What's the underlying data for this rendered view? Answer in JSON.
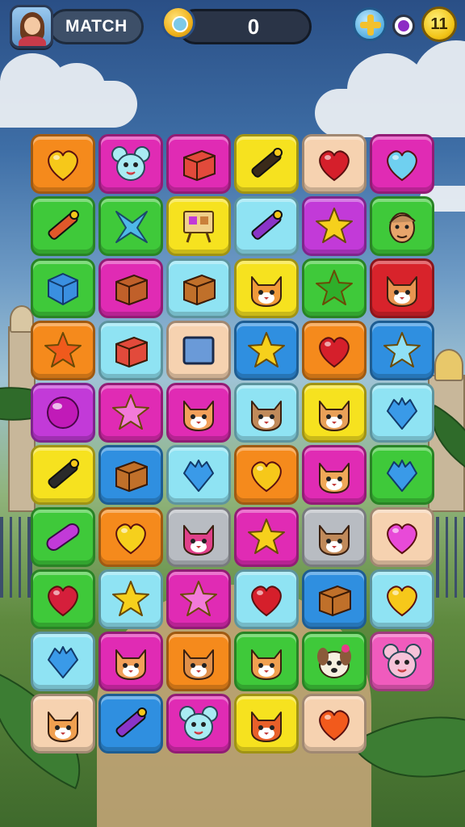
{
  "header": {
    "mode_label": "MATCH",
    "score": "0",
    "coins": "11"
  },
  "icons": {
    "avatar": "player-avatar",
    "badge": "sun-badge-icon",
    "plus": "plus-icon",
    "toggle": "dot-icon",
    "coin": "coin-icon"
  },
  "tile_colors": {
    "orange": "#f58a1c",
    "magenta": "#e02bb4",
    "yellow": "#f6e21f",
    "peach": "#f6d2b0",
    "green": "#3fc93a",
    "cyan": "#8fe3f3",
    "blue": "#2f8fe0",
    "purple": "#c23ad8",
    "red": "#d8232b",
    "gray": "#b8bcc2",
    "pink": "#f05bbd"
  },
  "board": {
    "rows": 10,
    "cols": 6,
    "cells": [
      [
        {
          "bg": "orange",
          "icon": "heart",
          "color": "#f6c81a"
        },
        {
          "bg": "magenta",
          "icon": "mouse",
          "color": "#a9ecf3"
        },
        {
          "bg": "magenta",
          "icon": "box",
          "color": "#e24a3b"
        },
        {
          "bg": "yellow",
          "icon": "marker",
          "color": "#3a2a1a"
        },
        {
          "bg": "peach",
          "icon": "heart",
          "color": "#d51f2b"
        },
        {
          "bg": "magenta",
          "icon": "heart",
          "color": "#6fd0f0"
        }
      ],
      [
        {
          "bg": "green",
          "icon": "marker",
          "color": "#e0582a"
        },
        {
          "bg": "green",
          "icon": "star4",
          "color": "#4fb8e8"
        },
        {
          "bg": "yellow",
          "icon": "board",
          "color": "#c9803a"
        },
        {
          "bg": "cyan",
          "icon": "marker",
          "color": "#8a34c8"
        },
        {
          "bg": "purple",
          "icon": "star",
          "color": "#f6d01c"
        },
        {
          "bg": "green",
          "icon": "face",
          "color": "#e8a56b"
        }
      ],
      [
        {
          "bg": "green",
          "icon": "cube",
          "color": "#3a8fe0"
        },
        {
          "bg": "magenta",
          "icon": "box",
          "color": "#c0602a"
        },
        {
          "bg": "cyan",
          "icon": "box",
          "color": "#c0702a"
        },
        {
          "bg": "yellow",
          "icon": "cat",
          "color": "#f09a3a"
        },
        {
          "bg": "green",
          "icon": "star",
          "color": "#2fae2a"
        },
        {
          "bg": "red",
          "icon": "cat",
          "color": "#e89450"
        }
      ],
      [
        {
          "bg": "orange",
          "icon": "star",
          "color": "#f05a1c"
        },
        {
          "bg": "cyan",
          "icon": "box",
          "color": "#e24a3b"
        },
        {
          "bg": "peach",
          "icon": "square",
          "color": "#6a9ad8"
        },
        {
          "bg": "blue",
          "icon": "star",
          "color": "#f6d01c"
        },
        {
          "bg": "orange",
          "icon": "heart",
          "color": "#d51f2b"
        },
        {
          "bg": "blue",
          "icon": "star",
          "color": "#8fe0f6"
        }
      ],
      [
        {
          "bg": "purple",
          "icon": "ball",
          "color": "#c11ab8"
        },
        {
          "bg": "magenta",
          "icon": "star",
          "color": "#f27ad9"
        },
        {
          "bg": "magenta",
          "icon": "cat",
          "color": "#f2a05a"
        },
        {
          "bg": "cyan",
          "icon": "cat",
          "color": "#c08a5a"
        },
        {
          "bg": "yellow",
          "icon": "cat",
          "color": "#e8a058"
        },
        {
          "bg": "cyan",
          "icon": "diamond",
          "color": "#3a9ae8"
        }
      ],
      [
        {
          "bg": "yellow",
          "icon": "marker",
          "color": "#2a2a2a"
        },
        {
          "bg": "blue",
          "icon": "box",
          "color": "#c0702a"
        },
        {
          "bg": "cyan",
          "icon": "diamond",
          "color": "#3a9ae8"
        },
        {
          "bg": "orange",
          "icon": "heart",
          "color": "#f6c81a"
        },
        {
          "bg": "magenta",
          "icon": "cat",
          "color": "#f0a858"
        },
        {
          "bg": "green",
          "icon": "diamond",
          "color": "#3a9ae8"
        }
      ],
      [
        {
          "bg": "green",
          "icon": "pill",
          "color": "#c23ad8"
        },
        {
          "bg": "orange",
          "icon": "heart",
          "color": "#f6d01c"
        },
        {
          "bg": "gray",
          "icon": "cat",
          "color": "#e0408a"
        },
        {
          "bg": "magenta",
          "icon": "star",
          "color": "#f6d01c"
        },
        {
          "bg": "gray",
          "icon": "cat",
          "color": "#c08a5a"
        },
        {
          "bg": "peach",
          "icon": "heart",
          "color": "#e84ad8"
        }
      ],
      [
        {
          "bg": "green",
          "icon": "heart",
          "color": "#d51f3b"
        },
        {
          "bg": "cyan",
          "icon": "star",
          "color": "#f6d01c"
        },
        {
          "bg": "magenta",
          "icon": "star",
          "color": "#f27ad9"
        },
        {
          "bg": "cyan",
          "icon": "heart",
          "color": "#d51f2b"
        },
        {
          "bg": "blue",
          "icon": "box",
          "color": "#c0702a"
        },
        {
          "bg": "cyan",
          "icon": "heart",
          "color": "#f6c81a"
        }
      ],
      [
        {
          "bg": "cyan",
          "icon": "diamond",
          "color": "#3a9ae8"
        },
        {
          "bg": "magenta",
          "icon": "cat",
          "color": "#f2a05a"
        },
        {
          "bg": "orange",
          "icon": "cat",
          "color": "#e0904a"
        },
        {
          "bg": "green",
          "icon": "cat",
          "color": "#f0a050"
        },
        {
          "bg": "green",
          "icon": "dog",
          "color": "#8a5a3a"
        },
        {
          "bg": "pink",
          "icon": "mouse",
          "color": "#f6c2d8"
        }
      ],
      [
        {
          "bg": "peach",
          "icon": "cat",
          "color": "#f0a050"
        },
        {
          "bg": "blue",
          "icon": "marker",
          "color": "#8a34c8"
        },
        {
          "bg": "magenta",
          "icon": "mouse",
          "color": "#a9ecf3"
        },
        {
          "bg": "yellow",
          "icon": "cat",
          "color": "#e8602a"
        },
        {
          "bg": "peach",
          "icon": "heart",
          "color": "#f25a1c"
        },
        null
      ]
    ]
  }
}
